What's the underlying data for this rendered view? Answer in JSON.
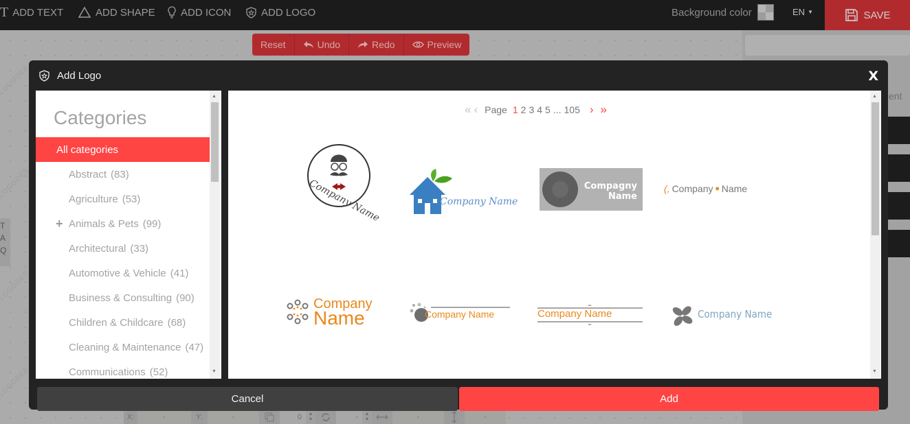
{
  "toolbar": {
    "tools": [
      {
        "label": "ADD TEXT",
        "icon": "text-icon"
      },
      {
        "label": "ADD SHAPE",
        "icon": "triangle-icon"
      },
      {
        "label": "ADD ICON",
        "icon": "lightbulb-icon"
      },
      {
        "label": "ADD LOGO",
        "icon": "shield-star-icon"
      }
    ],
    "background_color_label": "Background color",
    "language": "EN",
    "save_label": "SAVE"
  },
  "history": {
    "reset": "Reset",
    "undo": "Undo",
    "redo": "Redo",
    "preview": "Preview"
  },
  "canvas": {
    "watermark": "ELOGODES",
    "side_tab_letters": [
      "T",
      "A",
      "Q"
    ],
    "right_panel_label": "ent"
  },
  "bottom_bar": {
    "x_label": "X:",
    "x_value": "-",
    "y_label": "Y:",
    "y_value": "-",
    "layer_value": "0",
    "rotate_value": "-",
    "width_value": "-",
    "height_value": "-"
  },
  "modal": {
    "title": "Add Logo",
    "close_label": "X",
    "categories_title": "Categories",
    "categories": [
      {
        "name": "All categories",
        "count": "",
        "active": true,
        "expandable": false
      },
      {
        "name": "Abstract",
        "count": "(83)"
      },
      {
        "name": "Agriculture",
        "count": "(53)"
      },
      {
        "name": "Animals & Pets",
        "count": "(99)",
        "expandable": true
      },
      {
        "name": "Architectural",
        "count": "(33)"
      },
      {
        "name": "Automotive & Vehicle",
        "count": "(41)"
      },
      {
        "name": "Business & Consulting",
        "count": "(90)"
      },
      {
        "name": "Children & Childcare",
        "count": "(68)"
      },
      {
        "name": "Cleaning & Maintenance",
        "count": "(47)"
      },
      {
        "name": "Communications",
        "count": "(52)"
      }
    ],
    "pagination": {
      "label": "Page",
      "pages": [
        "1",
        "2",
        "3",
        "4",
        "5"
      ],
      "ellipsis": "...",
      "last_page": "105",
      "current_page": "1"
    },
    "logos": [
      {
        "text": "Company Name",
        "style": "mustache-circle"
      },
      {
        "text": "Company Name",
        "style": "house-leaf"
      },
      {
        "text_line1": "Compagny",
        "text_line2": "Name",
        "style": "vinyl-grey"
      },
      {
        "text": "Company",
        "text2": "Name",
        "style": "orange-bracket"
      },
      {
        "text_line1": "Company",
        "text_line2": "Name",
        "style": "dots-orange"
      },
      {
        "text": "Company Name",
        "style": "grey-sphere"
      },
      {
        "text": "Company Name",
        "style": "lined-orange"
      },
      {
        "text": "Company Name",
        "style": "propeller-blue"
      }
    ],
    "cancel_label": "Cancel",
    "add_label": "Add"
  },
  "colors": {
    "accent": "#ff4444",
    "toolbar_bg": "#1b1b1b",
    "save_bg": "#b12b2e",
    "modal_bg": "#232323",
    "logo_orange": "#e8891c",
    "logo_blue": "#3a7fc1"
  }
}
